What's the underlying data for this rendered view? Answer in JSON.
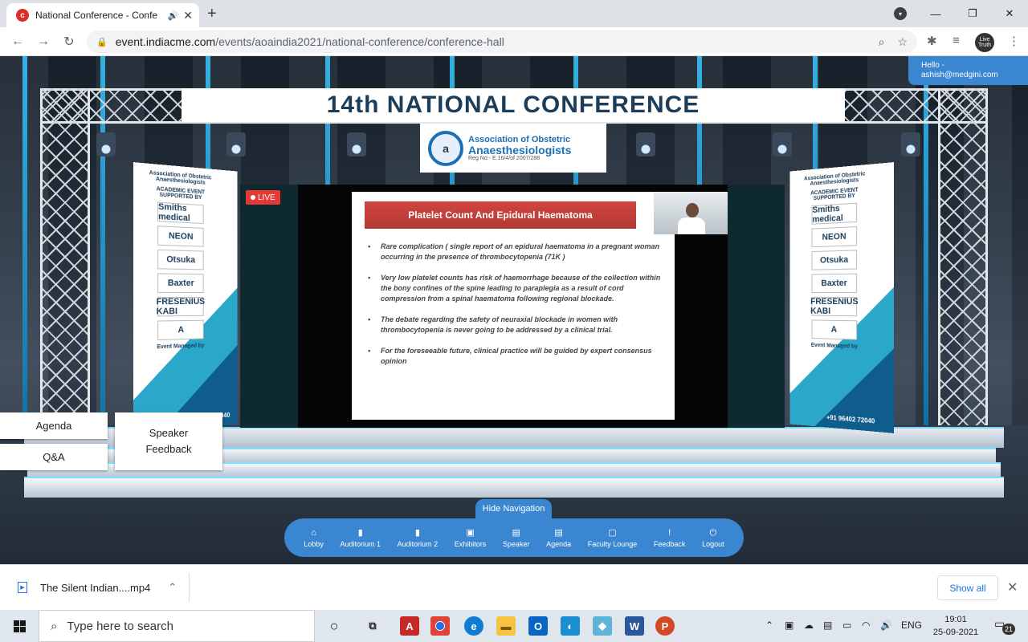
{
  "browser": {
    "tab_title": "National Conference - Confe",
    "favicon_letter": "c",
    "url_host": "event.indiacme.com",
    "url_path": "/events/aoaindia2021/national-conference/conference-hall",
    "avatar_text": "Live Truth"
  },
  "venue": {
    "conference_title": "14th NATIONAL CONFERENCE",
    "association": {
      "line1": "Association of Obstetric",
      "line2": "Anaesthesiologists",
      "reg": "Reg No:- E.16/4/of 2007/288"
    },
    "live_label": "LIVE",
    "hello_label": "Hello -",
    "user_email": "ashish@medgini.com",
    "sponsor_banner": {
      "header": "Association of Obstetric Anaesthesiologists",
      "supported_by": "ACADEMIC EVENT SUPPORTED BY",
      "sponsors": [
        "Smiths medical",
        "NEON",
        "Otsuka",
        "Baxter",
        "FRESENIUS KABI",
        "A"
      ],
      "managed_by": "Event Managed by",
      "phone": "+91 96402 72040",
      "phone_left": "2040"
    },
    "slide": {
      "title": "Platelet Count And Epidural Haematoma",
      "bullets": [
        "Rare complication ( single report of an epidural haematoma in a pregnant woman occurring in the presence of thrombocytopenia (71K )",
        "Very low platelet counts has risk of haemorrhage because of the collection within the bony confines of the spine leading to paraplegia as a result of cord compression from a spinal haematoma following regional blockade.",
        "The debate regarding the safety of neuraxial blockade in women with thrombocytopenia is never going to be addressed by a clinical trial.",
        "For the foreseeable future, clinical practice will be guided by expert consensus opinion"
      ]
    },
    "side_buttons": {
      "agenda": "Agenda",
      "qa": "Q&A",
      "speaker_feedback": "Speaker Feedback"
    },
    "hide_navigation": "Hide Navigation",
    "nav_items": [
      {
        "label": "Lobby",
        "icon": "⌂"
      },
      {
        "label": "Auditorium 1",
        "icon": "▮"
      },
      {
        "label": "Auditorium 2",
        "icon": "▮"
      },
      {
        "label": "Exhibitors",
        "icon": "▣"
      },
      {
        "label": "Speaker",
        "icon": "▤"
      },
      {
        "label": "Agenda",
        "icon": "▤"
      },
      {
        "label": "Faculty Lounge",
        "icon": "▢"
      },
      {
        "label": "Feedback",
        "icon": "!"
      },
      {
        "label": "Logout",
        "icon": "⏻"
      }
    ]
  },
  "downloads": {
    "file_name": "The Silent Indian....mp4",
    "show_all": "Show all"
  },
  "taskbar": {
    "search_placeholder": "Type here to search",
    "language": "ENG",
    "time": "19:01",
    "date": "25-09-2021",
    "notification_count": "21"
  }
}
